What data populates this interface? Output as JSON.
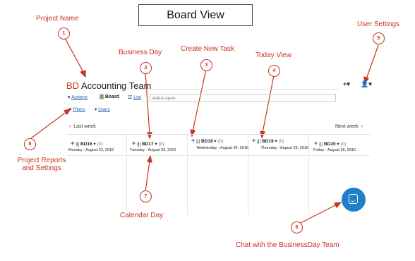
{
  "board_title": "Board View",
  "project": {
    "prefix": "BD",
    "name": "Accounting Team"
  },
  "toolbar": {
    "add_label": "+▾",
    "user_label": "👤▾"
  },
  "menu": {
    "actions": "Actions",
    "board": "Board",
    "list": "List",
    "search_value": "status:open",
    "filters": "Filters",
    "users": "Users"
  },
  "nav": {
    "prev": "Last week",
    "next": "Next week"
  },
  "days": [
    {
      "id": "BD16",
      "count": "(0)",
      "date": "Monday - August 22, 2016"
    },
    {
      "id": "BD17",
      "count": "(0)",
      "date": "Tuesday - August 23, 2016"
    },
    {
      "id": "BD18",
      "count": "(0)",
      "date": "Wednesday - August 24, 2016"
    },
    {
      "id": "BD19",
      "count": "(0)",
      "date": "Thursday - August 25, 2016"
    },
    {
      "id": "BD20",
      "count": "(0)",
      "date": "Friday - August 26, 2016"
    }
  ],
  "callouts": {
    "project_name": "Project Name",
    "business_day": "Business Day",
    "create_task": "Create New Task",
    "today_view": "Today View",
    "user_settings": "User Settings",
    "project_reports_1": "Project Reports",
    "project_reports_2": "and Settings",
    "calendar_day": "Calendar Day",
    "chat": "Chat with the BusinessDay Team"
  },
  "markers": [
    "1",
    "2",
    "3",
    "4",
    "5",
    "6",
    "7",
    "8"
  ],
  "colors": {
    "callout": "#c8321f",
    "link": "#2a5db0",
    "chat": "#1f7fc8"
  }
}
